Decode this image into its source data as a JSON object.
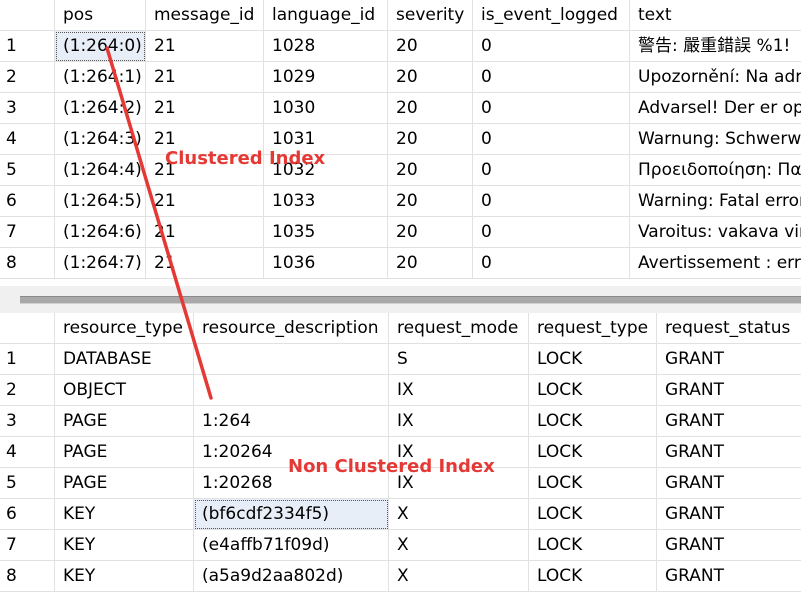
{
  "top_grid": {
    "columns": [
      "pos",
      "message_id",
      "language_id",
      "severity",
      "is_event_logged",
      "text"
    ],
    "rows": [
      {
        "num": "1",
        "cells": [
          "(1:264:0)",
          "21",
          "1028",
          "20",
          "0",
          "警告: 嚴重錯誤 %1!"
        ]
      },
      {
        "num": "2",
        "cells": [
          "(1:264:1)",
          "21",
          "1029",
          "20",
          "0",
          "Upozornění: Na adr"
        ]
      },
      {
        "num": "3",
        "cells": [
          "(1:264:2)",
          "21",
          "1030",
          "20",
          "0",
          "Advarsel! Der er ops"
        ]
      },
      {
        "num": "4",
        "cells": [
          "(1:264:3)",
          "21",
          "1031",
          "20",
          "0",
          "Warnung: Schwerw"
        ]
      },
      {
        "num": "5",
        "cells": [
          "(1:264:4)",
          "21",
          "1032",
          "20",
          "0",
          "Προειδοποίηση: Πα"
        ]
      },
      {
        "num": "6",
        "cells": [
          "(1:264:5)",
          "21",
          "1033",
          "20",
          "0",
          "Warning: Fatal error"
        ]
      },
      {
        "num": "7",
        "cells": [
          "(1:264:6)",
          "21",
          "1035",
          "20",
          "0",
          "Varoitus: vakava virh"
        ]
      },
      {
        "num": "8",
        "cells": [
          "(1:264:7)",
          "21",
          "1036",
          "20",
          "0",
          "Avertissement : erre"
        ]
      }
    ]
  },
  "bottom_grid": {
    "columns": [
      "resource_type",
      "resource_description",
      "request_mode",
      "request_type",
      "request_status"
    ],
    "rows": [
      {
        "num": "1",
        "cells": [
          "DATABASE",
          "",
          "S",
          "LOCK",
          "GRANT"
        ]
      },
      {
        "num": "2",
        "cells": [
          "OBJECT",
          "",
          "IX",
          "LOCK",
          "GRANT"
        ]
      },
      {
        "num": "3",
        "cells": [
          "PAGE",
          "1:264",
          "IX",
          "LOCK",
          "GRANT"
        ]
      },
      {
        "num": "4",
        "cells": [
          "PAGE",
          "1:20264",
          "IX",
          "LOCK",
          "GRANT"
        ]
      },
      {
        "num": "5",
        "cells": [
          "PAGE",
          "1:20268",
          "IX",
          "LOCK",
          "GRANT"
        ]
      },
      {
        "num": "6",
        "cells": [
          "KEY",
          "(bf6cdf2334f5)",
          "X",
          "LOCK",
          "GRANT"
        ]
      },
      {
        "num": "7",
        "cells": [
          "KEY",
          "(e4affb71f09d)",
          "X",
          "LOCK",
          "GRANT"
        ]
      },
      {
        "num": "8",
        "cells": [
          "KEY",
          "(a5a9d2aa802d)",
          "X",
          "LOCK",
          "GRANT"
        ]
      }
    ]
  },
  "annotations": {
    "clustered_label": "Clustered Index",
    "nonclustered_label": "Non Clustered Index",
    "color": "#e53935"
  }
}
